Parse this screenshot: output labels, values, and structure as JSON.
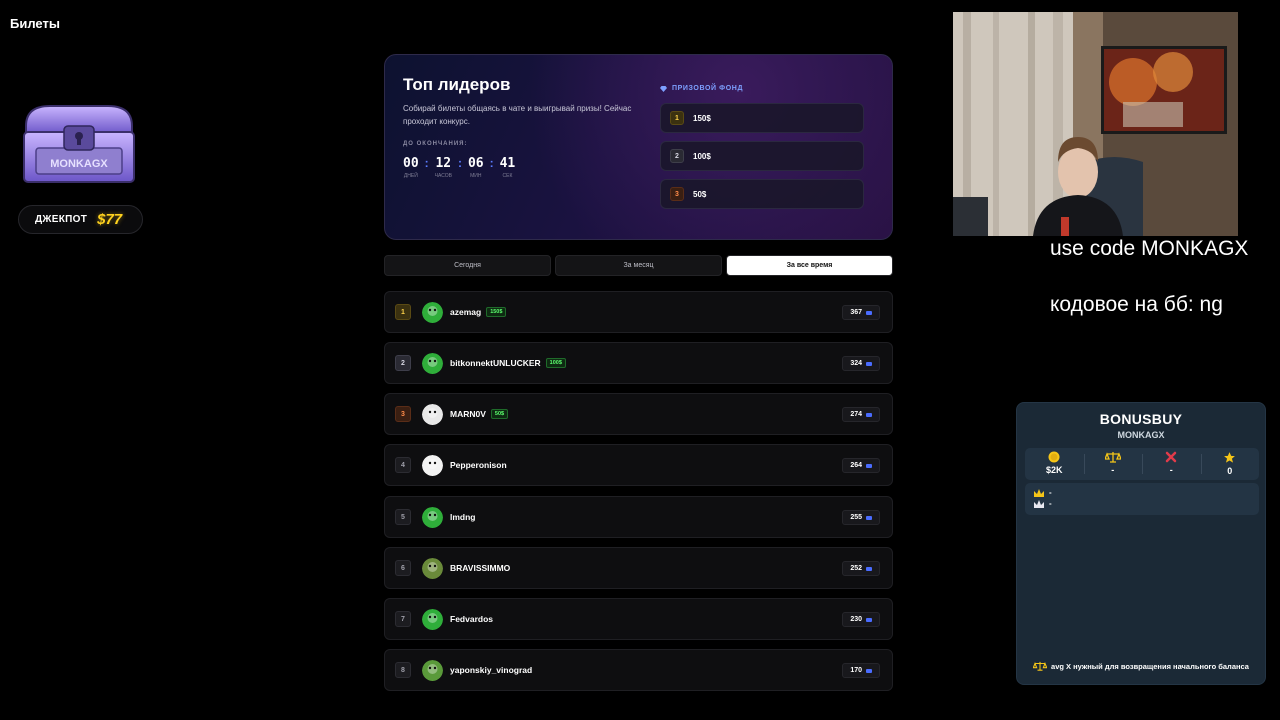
{
  "page": {
    "title": "Билеты"
  },
  "chest": {
    "label": "MONKAGX"
  },
  "jackpot": {
    "label": "ДЖЕКПОТ",
    "value": "$77"
  },
  "leaderboard": {
    "title": "Топ лидеров",
    "description": "Собирай билеты общаясь в чате и выигрывай призы! Сейчас проходит конкурс.",
    "until_label": "ДО ОКОНЧАНИЯ:",
    "timer": [
      {
        "value": "00",
        "label": "ДНЕЙ"
      },
      {
        "value": "12",
        "label": "ЧАСОВ"
      },
      {
        "value": "06",
        "label": "МИН"
      },
      {
        "value": "41",
        "label": "СЕК"
      }
    ],
    "prize_header": "ПРИЗОВОЙ ФОНД",
    "prizes": [
      {
        "rank": "1",
        "amount": "150$"
      },
      {
        "rank": "2",
        "amount": "100$"
      },
      {
        "rank": "3",
        "amount": "50$"
      }
    ]
  },
  "tabs": [
    {
      "label": "Сегодня",
      "active": false
    },
    {
      "label": "За месяц",
      "active": false
    },
    {
      "label": "За все время",
      "active": true
    }
  ],
  "rows": [
    {
      "rank": "1",
      "name": "azemag",
      "prize": "150$",
      "score": "367"
    },
    {
      "rank": "2",
      "name": "bitkonnektUNLUCKER",
      "prize": "100$",
      "score": "324"
    },
    {
      "rank": "3",
      "name": "MARN0V",
      "prize": "50$",
      "score": "274"
    },
    {
      "rank": "4",
      "name": "Pepperonison",
      "prize": "",
      "score": "264"
    },
    {
      "rank": "5",
      "name": "lmdng",
      "prize": "",
      "score": "255"
    },
    {
      "rank": "6",
      "name": "BRAVISSIMMO",
      "prize": "",
      "score": "252"
    },
    {
      "rank": "7",
      "name": "Fedvardos",
      "prize": "",
      "score": "230"
    },
    {
      "rank": "8",
      "name": "yaponskiy_vinograd",
      "prize": "",
      "score": "170"
    }
  ],
  "overlay": {
    "line1": "use code MONKAGX",
    "line2": "кодовое на бб: ng"
  },
  "bonusbuy": {
    "title": "BONUSBUY",
    "subtitle": "MONKAGX",
    "stats": [
      {
        "icon": "coin-icon",
        "value": "$2K"
      },
      {
        "icon": "scales-icon",
        "value": "-"
      },
      {
        "icon": "cross-icon",
        "value": "-"
      },
      {
        "icon": "star-icon",
        "value": "0"
      }
    ],
    "best": "-",
    "worst": "-",
    "footer": "avg X нужный для возвращения начального баланса"
  },
  "colors": {
    "accent": "#5b7cff",
    "gold": "#ffd21e",
    "prize_green": "#5cff6e"
  }
}
